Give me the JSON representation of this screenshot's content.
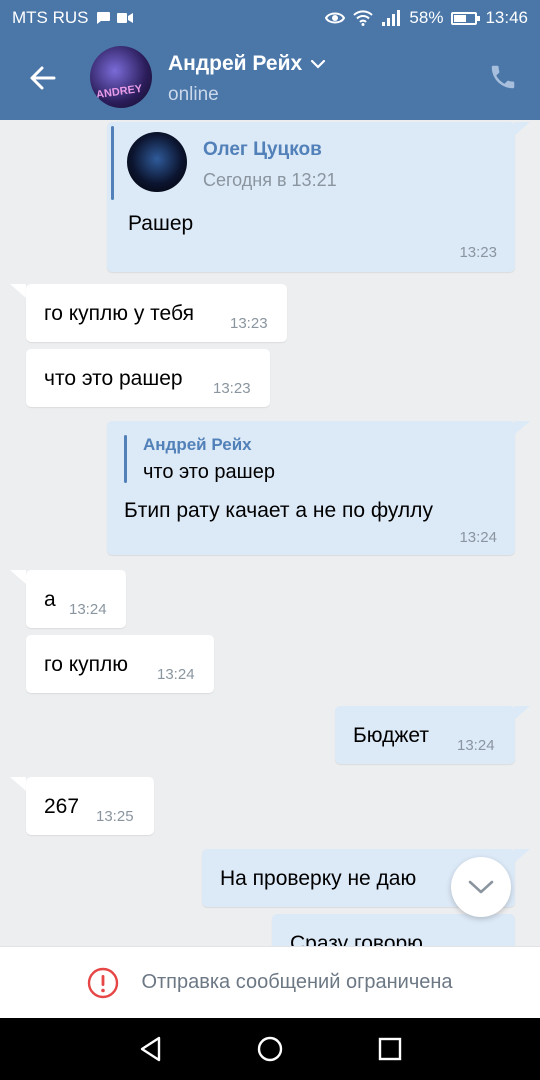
{
  "status_bar": {
    "carrier": "MTS RUS",
    "battery": "58%",
    "battery_level": 0.58,
    "time": "13:46"
  },
  "header": {
    "name": "Андрей Рейх",
    "status": "online",
    "avatar_text": "ANDREY"
  },
  "messages": [
    {
      "dir": "out",
      "type": "forward",
      "fwd_name": "Олег Цуцков",
      "fwd_date": "Сегодня в 13:21",
      "text": "Рашер",
      "time": "13:23"
    },
    {
      "dir": "in",
      "text": "го куплю у тебя",
      "time": "13:23"
    },
    {
      "dir": "in",
      "text": "что это рашер",
      "time": "13:23"
    },
    {
      "dir": "out",
      "type": "reply",
      "reply_name": "Андрей Рейх",
      "reply_text": "что это рашер",
      "text": "Бтип рату качает а не по фуллу",
      "time": "13:24"
    },
    {
      "dir": "in",
      "text": "а",
      "time": "13:24"
    },
    {
      "dir": "in",
      "text": "го куплю",
      "time": "13:24"
    },
    {
      "dir": "out",
      "text": "Бюджет",
      "time": "13:24"
    },
    {
      "dir": "in",
      "text": "267",
      "time": "13:25"
    },
    {
      "dir": "out",
      "text": "На проверку не даю",
      "time": ""
    },
    {
      "dir": "out",
      "text": "Сразу говорю",
      "time": ""
    }
  ],
  "restricted": {
    "text": "Отправка сообщений ограничена"
  },
  "colors": {
    "accent": "#4a76a8",
    "bubble_out": "#dce9f7",
    "bubble_in": "#ffffff",
    "background": "#edeef0",
    "warning": "#e64646"
  }
}
